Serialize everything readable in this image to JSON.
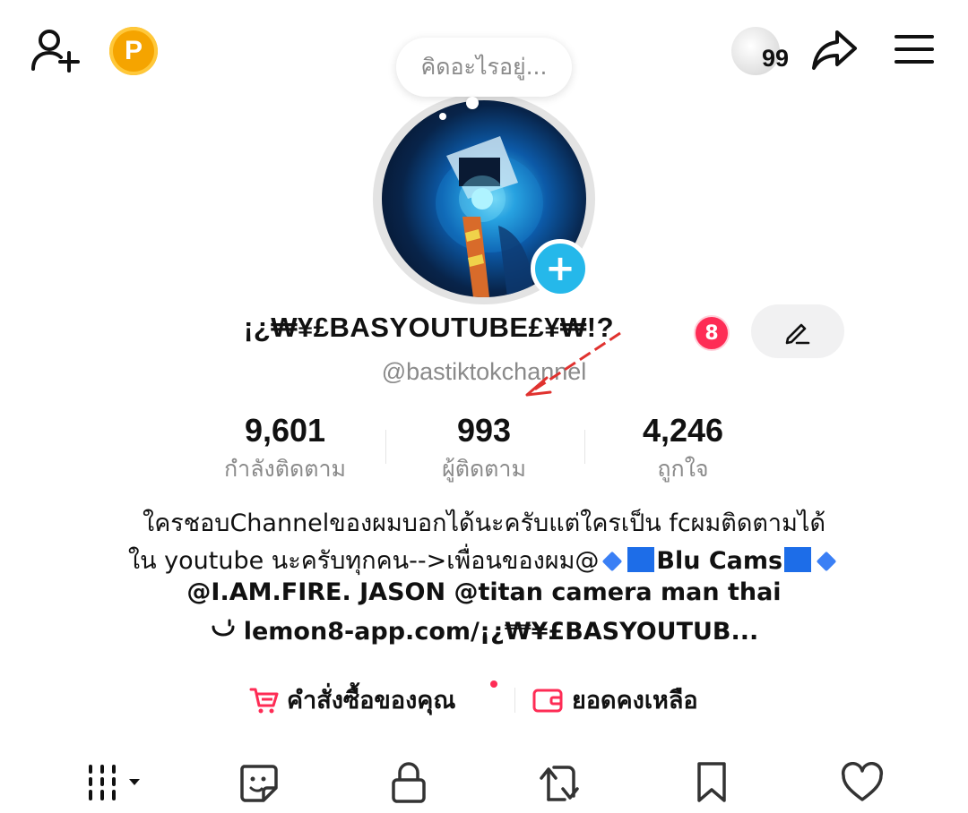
{
  "header": {
    "coin_label": "P",
    "notification_count": "99"
  },
  "thought_bubble": {
    "text": "คิดอะไรอยู่..."
  },
  "profile": {
    "display_name": "¡¿₩¥£BASYOUTUBE£¥₩!?",
    "name_badge": "8",
    "username": "@bastiktokchannel"
  },
  "stats": [
    {
      "value": "9,601",
      "label": "กำลังติดตาม"
    },
    {
      "value": "993",
      "label": "ผู้ติดตาม"
    },
    {
      "value": "4,246",
      "label": "ถูกใจ"
    }
  ],
  "bio": {
    "line1": "ใครชอบChannelของผมบอกได้นะครับแต่ใครเป็น fcผมติดตามได้",
    "line2_prefix": "ใน youtube นะครับทุกคน-->เพื่อนของผม@",
    "line2_bold": "Blu Cams",
    "line3": "@I.AM.FIRE. JASON @titan camera man thai",
    "link": "lemon8-app.com/¡¿₩¥£BASYOUTUB..."
  },
  "shortcuts": {
    "orders_label": "คำสั่งซื้อของคุณ",
    "balance_label": "ยอดคงเหลือ"
  },
  "colors": {
    "accent": "#fe2c55",
    "avatar_add": "#25b8ea",
    "coin": "#f5a400",
    "annotation_arrow": "#e0322f"
  },
  "icons": {
    "add_friend": "add-user-icon",
    "share": "share-icon",
    "menu": "hamburger-menu-icon",
    "edit": "pencil-icon",
    "cart": "cart-icon",
    "wallet": "wallet-icon",
    "tab_videos": "grid-icon",
    "tab_stickers": "sticker-icon",
    "tab_private": "lock-icon",
    "tab_reposts": "repost-icon",
    "tab_saved": "bookmark-icon",
    "tab_liked": "heart-icon"
  }
}
